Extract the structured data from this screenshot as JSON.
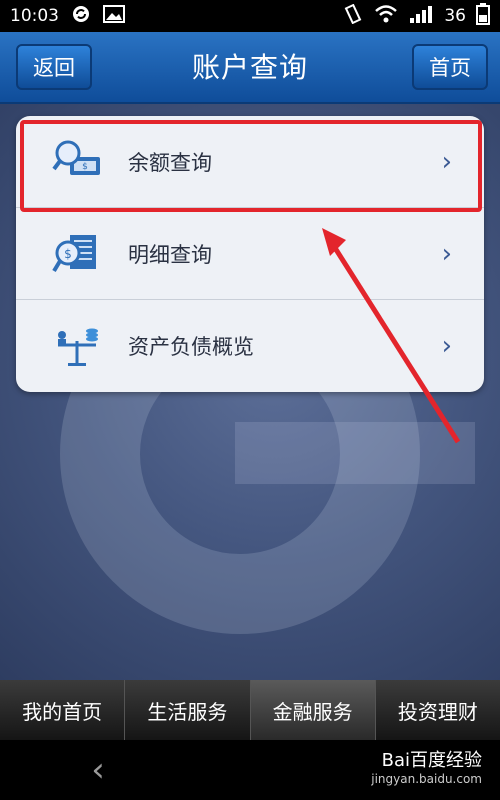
{
  "status_bar": {
    "time": "10:03",
    "battery": "36"
  },
  "header": {
    "back_label": "返回",
    "title": "账户查询",
    "home_label": "首页"
  },
  "menu": [
    {
      "label": "余额查询",
      "icon": "balance-search-icon"
    },
    {
      "label": "明细查询",
      "icon": "statement-search-icon"
    },
    {
      "label": "资产负债概览",
      "icon": "assets-scale-icon"
    }
  ],
  "tabs": [
    {
      "label": "我的首页"
    },
    {
      "label": "生活服务"
    },
    {
      "label": "金融服务",
      "active": true
    },
    {
      "label": "投资理财"
    }
  ],
  "watermark": {
    "brand": "Bai百度经验",
    "url": "jingyan.baidu.com"
  },
  "colors": {
    "header_blue": "#1a5fb0",
    "highlight_red": "#e3252c",
    "tab_bg": "#2a2a2a"
  }
}
